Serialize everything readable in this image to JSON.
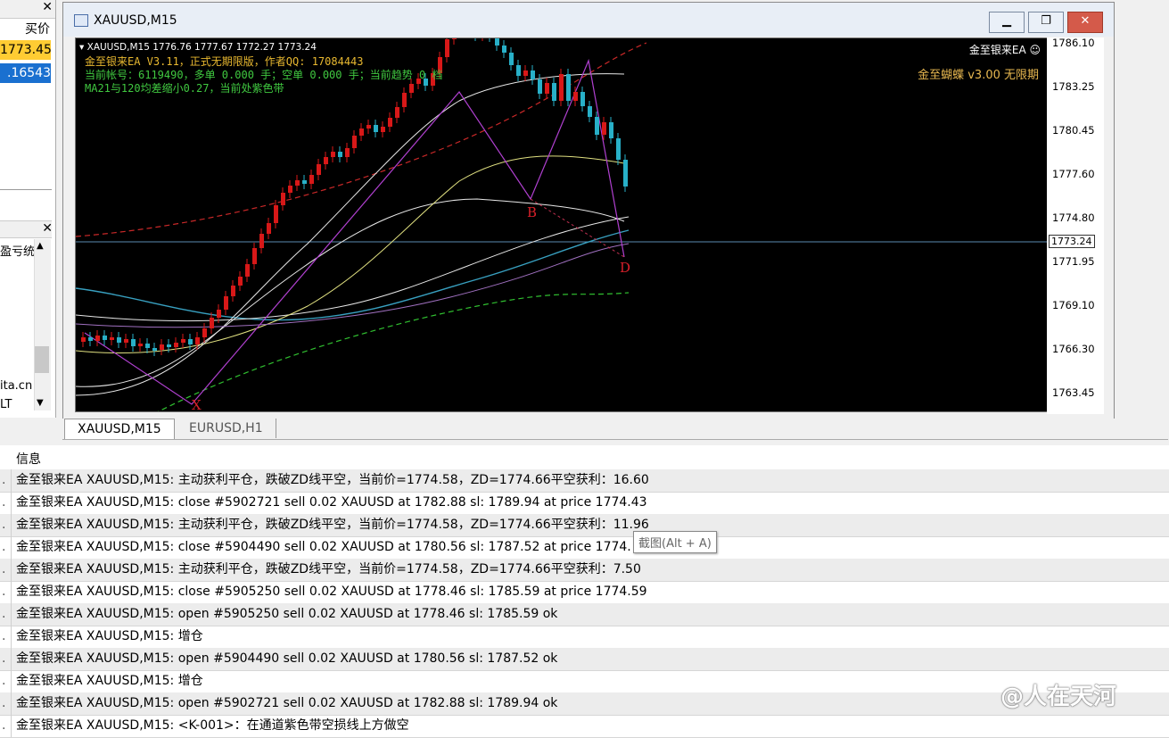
{
  "left_panel": {
    "column_header": "买价",
    "quotes": [
      "1773.45",
      ".16543"
    ],
    "items": [
      "盈亏统",
      "ita.cn",
      "LT"
    ]
  },
  "chart_window": {
    "title": "XAUUSD,M15",
    "ohlc": "XAUUSD,M15  1776.76 1777.67 1772.27 1773.24",
    "ea_lines": [
      "金至银来EA V3.11，正式无期限版，作者QQ: 17084443",
      "当前帐号：6119490，多单 0.000 手；空单 0.000 手；当前趋势 0 档",
      "MA21与120均差缩小0.27，当前处紫色带"
    ],
    "ea_name": "金至银来EA ☺",
    "butterfly": "金至蝴蝶 v3.00 无限期",
    "current_price": "1773.24",
    "pattern_labels": [
      "B",
      "D",
      "X"
    ],
    "price_ticks": [
      "1786.10",
      "1783.25",
      "1780.45",
      "1777.60",
      "1774.80",
      "1771.95",
      "1769.10",
      "1766.30",
      "1763.45"
    ],
    "colors": {
      "bull": "#d81818",
      "bear": "#28b0c8",
      "ma_white": "#e8e8e8",
      "ma_yellow": "#e0e080",
      "ma_cyan": "#38a0c0",
      "ma_purple": "#a070c0",
      "ma_green": "#30c030",
      "channel_red": "#c82828"
    }
  },
  "tabs": [
    {
      "label": "XAUUSD,M15",
      "active": true
    },
    {
      "label": "EURUSD,H1",
      "active": false
    }
  ],
  "log": {
    "header": "信息",
    "rows": [
      "金至银来EA XAUUSD,M15: 主动获利平仓，跌破ZD线平空，当前价=1774.58，ZD=1774.66平空获利：16.60",
      "金至银来EA XAUUSD,M15: close #5902721 sell 0.02 XAUUSD at 1782.88 sl: 1789.94 at price 1774.43",
      "金至银来EA XAUUSD,M15: 主动获利平仓，跌破ZD线平空，当前价=1774.58，ZD=1774.66平空获利：11.96",
      "金至银来EA XAUUSD,M15: close #5904490 sell 0.02 XAUUSD at 1780.56 sl: 1787.52 at price 1774.",
      "金至银来EA XAUUSD,M15: 主动获利平仓，跌破ZD线平空，当前价=1774.58，ZD=1774.66平空获利：7.50",
      "金至银来EA XAUUSD,M15: close #5905250 sell 0.02 XAUUSD at 1778.46 sl: 1785.59 at price 1774.59",
      "金至银来EA XAUUSD,M15: open #5905250 sell 0.02 XAUUSD at 1778.46 sl: 1785.59 ok",
      "金至银来EA XAUUSD,M15: 增仓",
      "金至银来EA XAUUSD,M15: open #5904490 sell 0.02 XAUUSD at 1780.56 sl: 1787.52 ok",
      "金至银来EA XAUUSD,M15: 增仓",
      "金至银来EA XAUUSD,M15: open #5902721 sell 0.02 XAUUSD at 1782.88 sl: 1789.94 ok",
      "金至银来EA XAUUSD,M15: <K-001>：在通道紫色带空损线上方做空"
    ]
  },
  "tooltip": "截图(Alt + A)",
  "watermark": "@人在天河"
}
